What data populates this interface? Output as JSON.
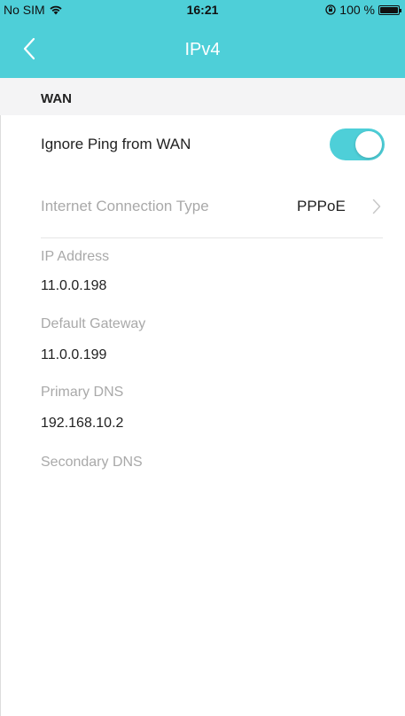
{
  "status_bar": {
    "carrier": "No SIM",
    "time": "16:21",
    "battery_text": "100 %",
    "icons": [
      "wifi-icon",
      "lock-rotation-icon",
      "battery-icon"
    ]
  },
  "nav": {
    "title": "IPv4",
    "back_icon": "back-chevron-icon"
  },
  "section": {
    "title": "WAN"
  },
  "ignore_ping": {
    "label": "Ignore Ping from WAN",
    "enabled": true
  },
  "connection": {
    "label": "Internet Connection Type",
    "value": "PPPoE",
    "chevron_icon": "chevron-right-icon"
  },
  "fields": [
    {
      "label": "IP Address",
      "value": "11.0.0.198"
    },
    {
      "label": "Default Gateway",
      "value": "11.0.0.199"
    },
    {
      "label": "Primary DNS",
      "value": "192.168.10.2"
    },
    {
      "label": "Secondary DNS",
      "value": ""
    }
  ],
  "colors": {
    "accent": "#4ecfd8",
    "section_bg": "#f4f4f5",
    "muted_text": "#a9a9a9"
  }
}
